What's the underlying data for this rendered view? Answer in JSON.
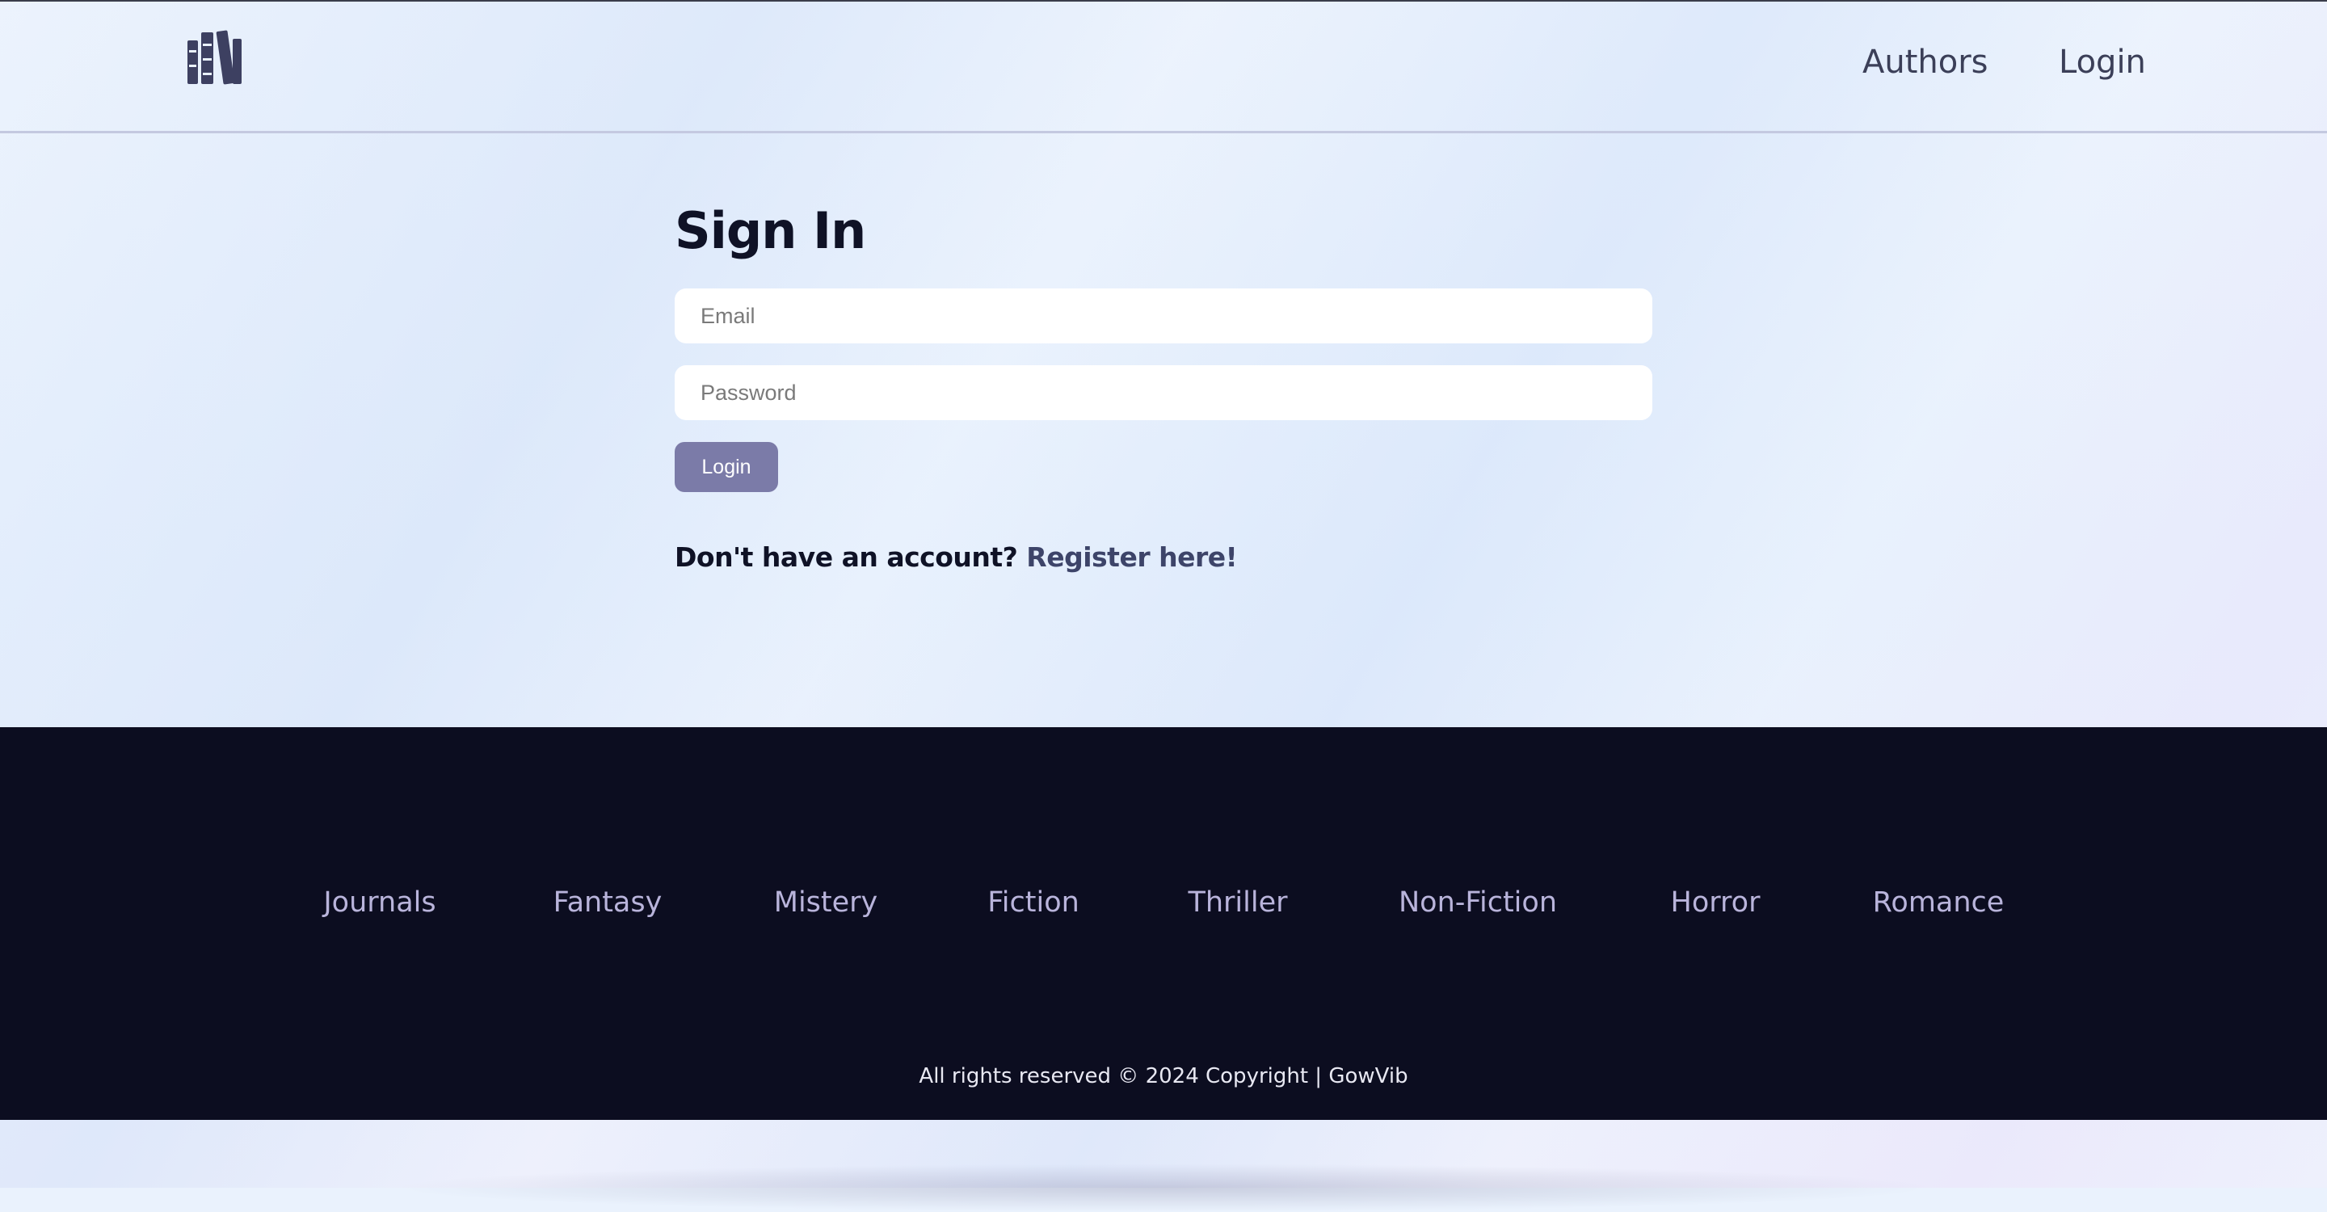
{
  "header": {
    "logo_icon": "bookshelf-icon",
    "nav": [
      {
        "label": "Authors"
      },
      {
        "label": "Login"
      }
    ]
  },
  "signin": {
    "title": "Sign In",
    "email_placeholder": "Email",
    "password_placeholder": "Password",
    "login_button": "Login",
    "register_prompt": "Don't have an account?",
    "register_link": "Register here!"
  },
  "footer": {
    "genres": [
      {
        "label": "Journals"
      },
      {
        "label": "Fantasy"
      },
      {
        "label": "Mistery"
      },
      {
        "label": "Fiction"
      },
      {
        "label": "Thriller"
      },
      {
        "label": "Non-Fiction"
      },
      {
        "label": "Horror"
      },
      {
        "label": "Romance"
      }
    ],
    "copyright": "All rights reserved © 2024 Copyright | GowVib"
  },
  "colors": {
    "accent_button": "#7b7ba8",
    "footer_bg": "#0c0d20",
    "footer_link": "#b9b4db",
    "heading": "#0f1226",
    "logo": "#3d4061"
  }
}
